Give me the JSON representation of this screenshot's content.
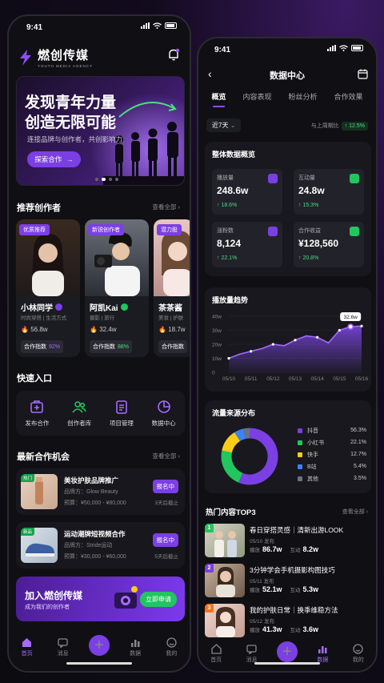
{
  "left": {
    "status_time": "9:41",
    "brand": {
      "name": "燃创传媒",
      "sub": "YOUTH MEDIA AGENCY"
    },
    "banner": {
      "line1": "发现青年力量",
      "line2": "创造无限可能",
      "desc": "连接品牌与创作者，共创影响力",
      "cta": "探索合作"
    },
    "recommend": {
      "title": "推荐创作者",
      "more": "查看全部"
    },
    "creators": [
      {
        "tag": "优质推荐",
        "name": "小林同学",
        "cat": "时尚穿搭 | 生活方式",
        "fans": "56.8w",
        "idx_label": "合作指数",
        "idx": "92%"
      },
      {
        "tag": "新锐创作者",
        "name": "阿凯Kai",
        "cat": "摄影 | 旅行",
        "fans": "32.4w",
        "idx_label": "合作指数",
        "idx": "88%"
      },
      {
        "tag": "潜力股",
        "name": "茶茶酱",
        "cat": "美妆 | 护肤",
        "fans": "18.7w",
        "idx_label": "合作指数",
        "idx": ""
      }
    ],
    "quick": {
      "title": "快速入口",
      "items": [
        "发布合作",
        "创作者库",
        "项目管理",
        "数据中心"
      ]
    },
    "opps": {
      "title": "最新合作机会",
      "more": "查看全部"
    },
    "opp_items": [
      {
        "badge": "热门",
        "title": "美妆护肤品牌推广",
        "brand": "品牌方：Glow Beauty",
        "budget": "预算：¥50,000 - ¥80,000",
        "apply": "报名中",
        "deadline": "3天后截止"
      },
      {
        "badge": "新品",
        "title": "运动潮牌短视频合作",
        "brand": "品牌方：Stride运动",
        "budget": "预算：¥30,000 - ¥60,000",
        "apply": "报名中",
        "deadline": "5天后截止"
      }
    ],
    "join": {
      "title": "加入燃创传媒",
      "sub": "成为我们的创作者",
      "btn": "立即申请"
    },
    "tabbar": [
      "首页",
      "消息",
      "",
      "数据",
      "我的"
    ]
  },
  "right": {
    "status_time": "9:41",
    "title": "数据中心",
    "tabs": [
      "概览",
      "内容表现",
      "粉丝分析",
      "合作效果"
    ],
    "filter": "近7天",
    "compare_label": "与上周期比",
    "compare_value": "↑ 12.5%",
    "overview_title": "整体数据概览",
    "kpis": [
      {
        "label": "播放量",
        "value": "248.6w",
        "change": "↑ 18.6%",
        "color": "#7b3fe4"
      },
      {
        "label": "互动量",
        "value": "24.8w",
        "change": "↑ 15.3%",
        "color": "#22c55e"
      },
      {
        "label": "涨粉数",
        "value": "8,124",
        "change": "↑ 22.1%",
        "color": "#7b3fe4"
      },
      {
        "label": "合作收益",
        "value": "¥128,560",
        "change": "↑ 20.8%",
        "color": "#22c55e"
      }
    ],
    "trend_title": "播放量趋势",
    "trend_tooltip": "32.6w",
    "source_title": "流量来源分布",
    "hot_title": "热门内容TOP3",
    "hot_more": "查看全部",
    "hot": [
      {
        "rank": "1",
        "title": "春日穿搭灵感｜清新出游LOOK",
        "date": "05/10 发布",
        "play_label": "播放",
        "play": "86.7w",
        "inter_label": "互动",
        "inter": "8.2w",
        "rank_color": "#22c55e"
      },
      {
        "rank": "2",
        "title": "3分钟学会手机摄影构图技巧",
        "date": "05/11 发布",
        "play_label": "播放",
        "play": "52.1w",
        "inter_label": "互动",
        "inter": "5.3w",
        "rank_color": "#7b3fe4"
      },
      {
        "rank": "3",
        "title": "我的护肤日常｜换季维稳方法",
        "date": "05/12 发布",
        "play_label": "播放",
        "play": "41.3w",
        "inter_label": "互动",
        "inter": "3.6w",
        "rank_color": "#f97316"
      }
    ],
    "tabbar": [
      "首页",
      "消息",
      "",
      "数据",
      "我的"
    ]
  },
  "chart_data": [
    {
      "type": "area",
      "title": "播放量趋势",
      "x": [
        "05/10",
        "05/11",
        "05/12",
        "05/13",
        "05/14",
        "05/15",
        "05/16"
      ],
      "xticks": [
        "05/10",
        "05/11",
        "05/12",
        "05/13",
        "05/14",
        "05/15",
        "05/16"
      ],
      "values": [
        10,
        13,
        15,
        17,
        20,
        19,
        23,
        26,
        25,
        21,
        30,
        32.6,
        33
      ],
      "value_x": [
        0,
        0.5,
        1,
        1.5,
        2,
        2.5,
        3,
        3.5,
        4,
        4.5,
        5,
        5.5,
        6
      ],
      "yticks": [
        "0",
        "10w",
        "20w",
        "30w",
        "40w"
      ],
      "ylim": [
        0,
        40
      ],
      "highlight": {
        "x": 5.5,
        "y": 32.6,
        "label": "32.6w"
      },
      "color": "#8b4dff"
    },
    {
      "type": "pie",
      "title": "流量来源分布",
      "categories": [
        "抖音",
        "小红书",
        "快手",
        "B站",
        "其他"
      ],
      "values": [
        56.3,
        22.1,
        12.7,
        5.4,
        3.5
      ],
      "labels": [
        "56.3%",
        "22.1%",
        "12.7%",
        "5.4%",
        "3.5%"
      ],
      "colors": [
        "#7b3fe4",
        "#22c55e",
        "#facc15",
        "#3b82f6",
        "#6b7280"
      ]
    }
  ]
}
